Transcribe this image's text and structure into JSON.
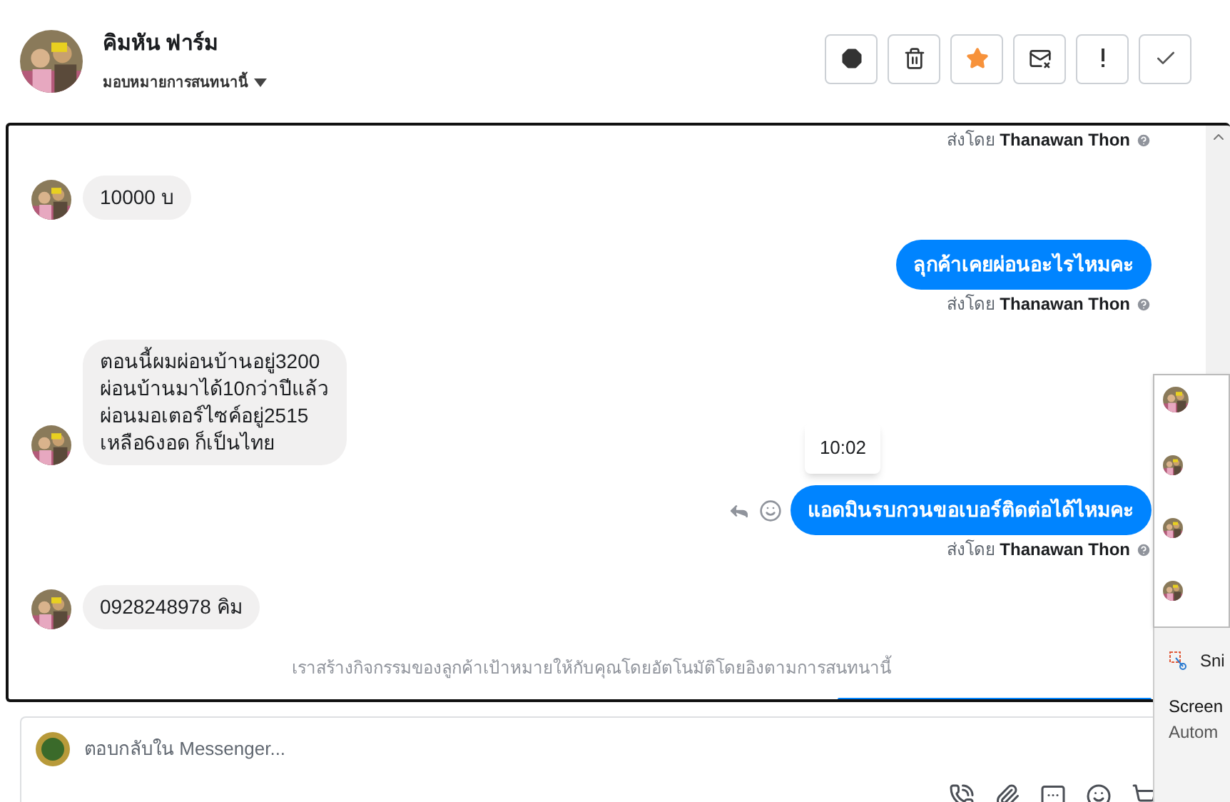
{
  "header": {
    "name": "คิมหัน ฟาร์ม",
    "assign": "มอบหมายการสนทนานี้",
    "actions": [
      {
        "kind": "alert"
      },
      {
        "kind": "trash"
      },
      {
        "kind": "star"
      },
      {
        "kind": "mail"
      },
      {
        "kind": "exclaim"
      },
      {
        "kind": "check"
      }
    ]
  },
  "messages": [
    {
      "kind": "sender",
      "prefix": "ส่งโดย",
      "name": "Thanawan Thon"
    },
    {
      "kind": "incoming",
      "lines": [
        "10000 บ"
      ]
    },
    {
      "kind": "outgoing",
      "lines": [
        "ลุกค้าเคยผ่อนอะไรไหมคะ"
      ]
    },
    {
      "kind": "sender",
      "prefix": "ส่งโดย",
      "name": "Thanawan Thon"
    },
    {
      "kind": "incoming",
      "lines": [
        "ตอนนี้ผมผ่อนบ้านอยู่3200",
        "ผ่อนบ้านมาได้10กว่าปีแล้ว",
        "ผ่อนมอเตอร์ไซค์อยู่2515",
        "เหลือ6งอด ก็เป็นไทย"
      ]
    },
    {
      "kind": "outgoing",
      "lines": [
        "แอดมินรบกวนขอเบอร์ติดต่อได้ไหมคะ"
      ],
      "tooltip": "10:02"
    },
    {
      "kind": "sender",
      "prefix": "ส่งโดย",
      "name": "Thanawan Thon"
    },
    {
      "kind": "incoming",
      "lines": [
        "0928248978 คิม"
      ]
    },
    {
      "kind": "system",
      "text": "เราสร้างกิจกรรมของลูกค้าเป้าหมายให้กับคุณโดยอัตโนมัติโดยอิงตามการสนทนานี้"
    }
  ],
  "composer": {
    "placeholder": "ตอบกลับใน Messenger..."
  },
  "notification": {
    "app": "Sni",
    "title": "Screen",
    "body": "Autom"
  }
}
